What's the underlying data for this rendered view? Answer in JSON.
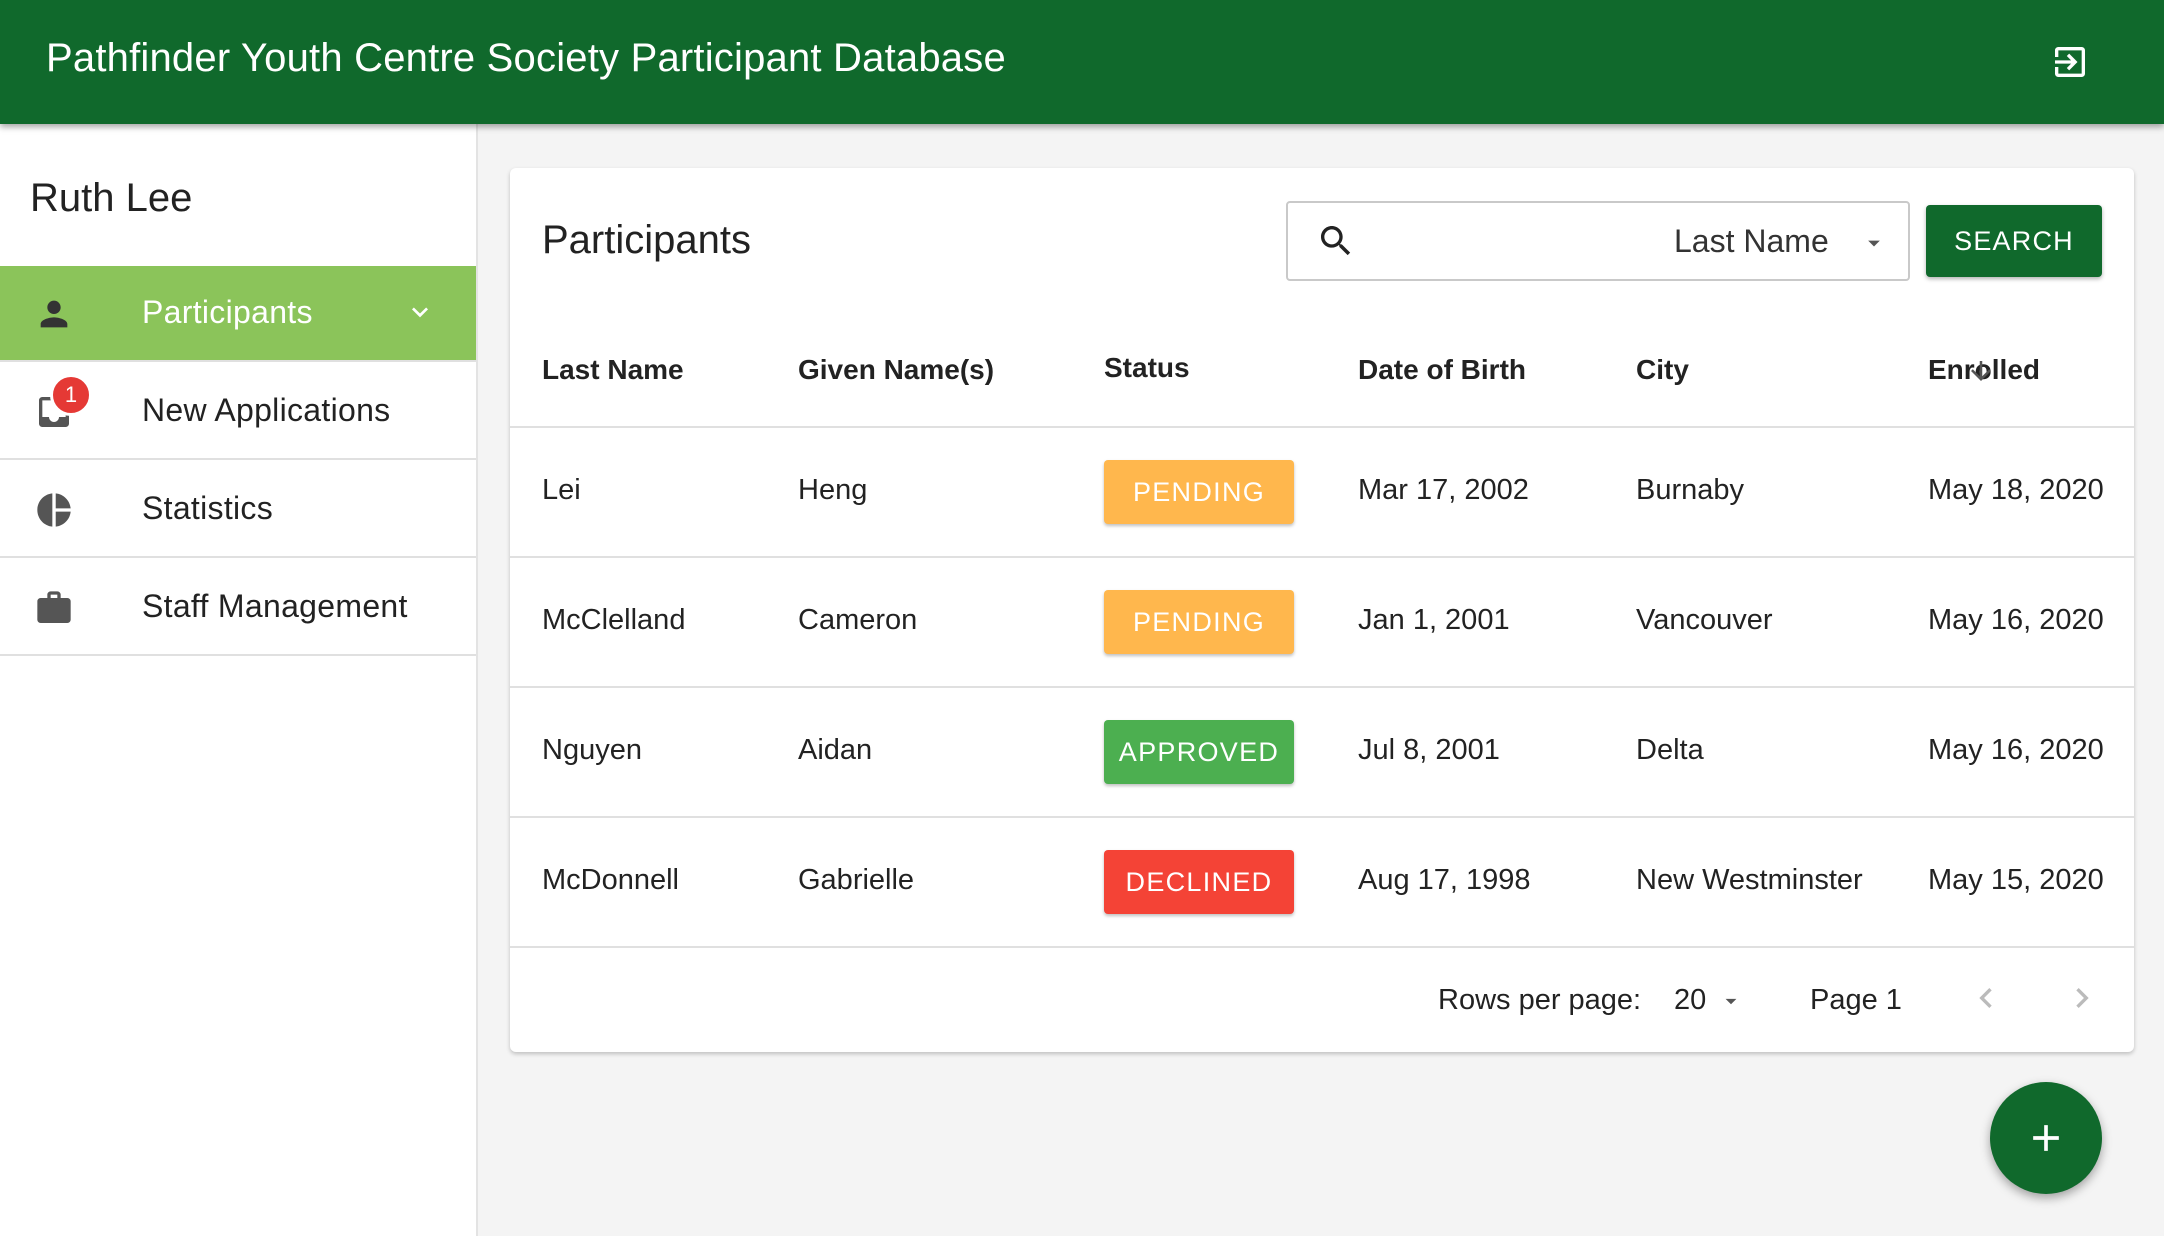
{
  "app": {
    "title": "Pathfinder Youth Centre Society Participant Database",
    "color_primary": "#10692c",
    "color_nav_active": "#8bc45a",
    "logout_icon": "logout-icon"
  },
  "sidebar": {
    "user_name": "Ruth Lee",
    "items": [
      {
        "label": "Participants",
        "icon": "person-icon",
        "active": true
      },
      {
        "label": "New Applications",
        "icon": "inbox-icon",
        "badge": "1"
      },
      {
        "label": "Statistics",
        "icon": "pie-chart-icon"
      },
      {
        "label": "Staff Management",
        "icon": "briefcase-icon"
      }
    ]
  },
  "main": {
    "title": "Participants",
    "search": {
      "value": "",
      "placeholder": "",
      "field_selected": "Last Name",
      "button_label": "SEARCH"
    },
    "table": {
      "columns": [
        "Last Name",
        "Given Name(s)",
        "Status",
        "Date of Birth",
        "City",
        "Enrolled"
      ],
      "sorted_column": "Enrolled",
      "sort_direction": "descending",
      "rows": [
        {
          "last_name": "Lei",
          "given_names": "Heng",
          "status": "PENDING",
          "dob": "Mar 17, 2002",
          "city": "Burnaby",
          "enrolled": "May 18, 2020"
        },
        {
          "last_name": "McClelland",
          "given_names": "Cameron",
          "status": "PENDING",
          "dob": "Jan 1, 2001",
          "city": "Vancouver",
          "enrolled": "May 16, 2020"
        },
        {
          "last_name": "Nguyen",
          "given_names": "Aidan",
          "status": "APPROVED",
          "dob": "Jul 8, 2001",
          "city": "Delta",
          "enrolled": "May 16, 2020"
        },
        {
          "last_name": "McDonnell",
          "given_names": "Gabrielle",
          "status": "DECLINED",
          "dob": "Aug 17, 1998",
          "city": "New Westminster",
          "enrolled": "May 15, 2020"
        }
      ],
      "status_colors": {
        "PENDING": "#ffb74d",
        "APPROVED": "#4caf50",
        "DECLINED": "#f44336"
      }
    },
    "pagination": {
      "rows_per_page_label": "Rows per page:",
      "rows_per_page": "20",
      "page_label": "Page 1"
    }
  },
  "fab": {
    "icon": "plus-icon"
  }
}
